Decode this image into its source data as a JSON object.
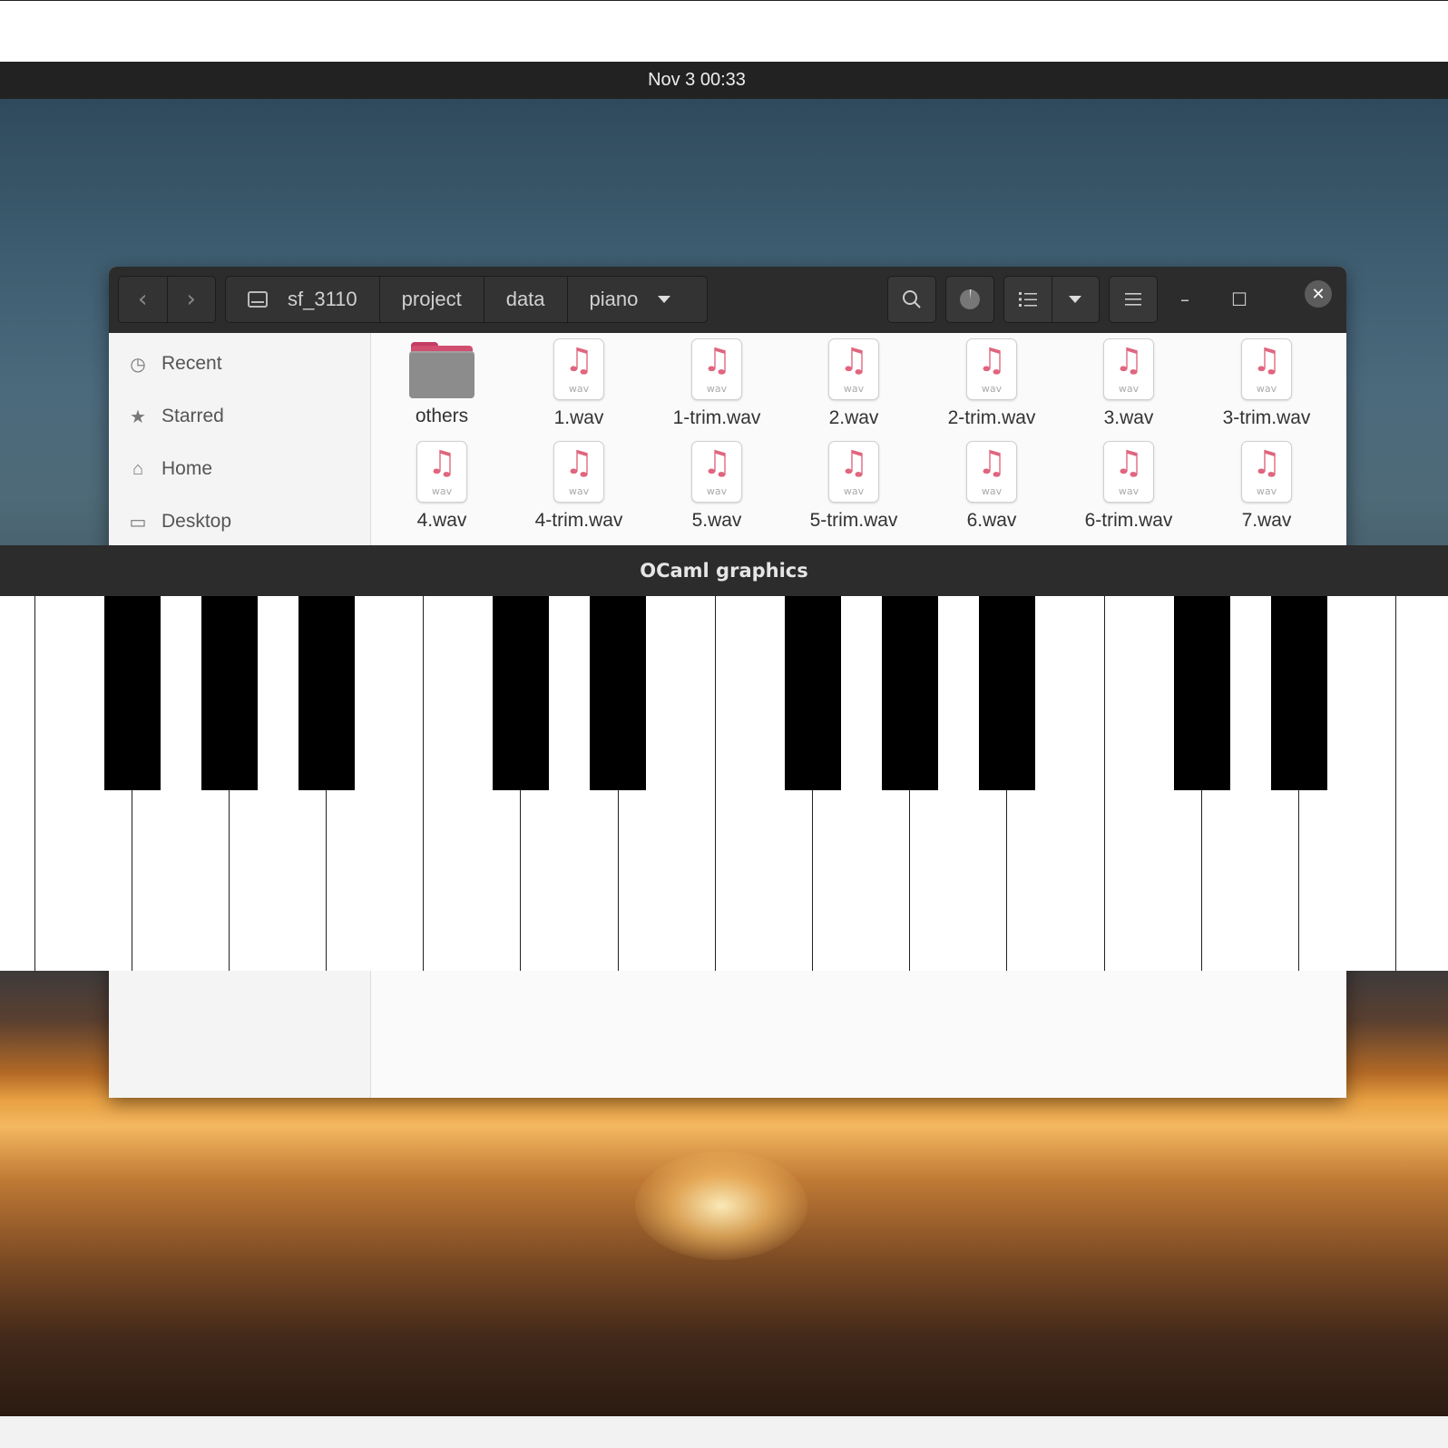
{
  "topbar": {
    "clock": "Nov 3  00:33"
  },
  "file_manager": {
    "breadcrumbs": [
      "sf_3110",
      "project",
      "data",
      "piano"
    ],
    "sidebar": [
      {
        "label": "Recent",
        "icon": "clock-icon"
      },
      {
        "label": "Starred",
        "icon": "star-icon"
      },
      {
        "label": "Home",
        "icon": "home-icon"
      },
      {
        "label": "Desktop",
        "icon": "desktop-icon"
      }
    ],
    "files": [
      {
        "name": "others",
        "type": "folder"
      },
      {
        "name": "1.wav",
        "type": "wav"
      },
      {
        "name": "1-trim.wav",
        "type": "wav"
      },
      {
        "name": "2.wav",
        "type": "wav"
      },
      {
        "name": "2-trim.wav",
        "type": "wav"
      },
      {
        "name": "3.wav",
        "type": "wav"
      },
      {
        "name": "3-trim.wav",
        "type": "wav"
      },
      {
        "name": "4.wav",
        "type": "wav"
      },
      {
        "name": "4-trim.wav",
        "type": "wav"
      },
      {
        "name": "5.wav",
        "type": "wav"
      },
      {
        "name": "5-trim.wav",
        "type": "wav"
      },
      {
        "name": "6.wav",
        "type": "wav"
      },
      {
        "name": "6-trim.wav",
        "type": "wav"
      },
      {
        "name": "7.wav",
        "type": "wav"
      }
    ],
    "wav_ext_label": "wav"
  },
  "ocaml_window": {
    "title": "OCaml graphics"
  },
  "piano": {
    "white_keys": 15,
    "black_keys": 10
  }
}
